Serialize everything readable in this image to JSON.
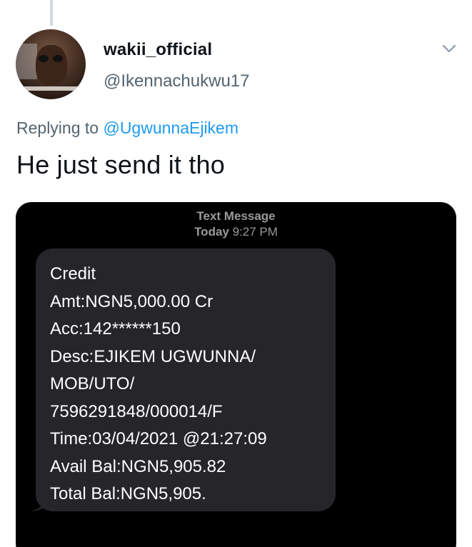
{
  "tweet": {
    "display_name": "wakii_official",
    "handle": "@Ikennachukwu17",
    "replying_prefix": "Replying to",
    "replying_to": "@UgwunnaEjikem",
    "text": "He just send it tho"
  },
  "icons": {
    "more": "chevron-down-icon",
    "avatar": "profile-photo"
  },
  "colors": {
    "accent": "#1d9bf0",
    "secondary_text": "#536471",
    "bubble": "#26252a",
    "media_bg": "#000000"
  },
  "sms": {
    "header_title": "Text Message",
    "header_day": "Today",
    "header_time": "9:27 PM",
    "lines": [
      "Credit",
      "Amt:NGN5,000.00 Cr",
      "Acc:142******150",
      "Desc:EJIKEM UGWUNNA/",
      "MOB/UTO/",
      "7596291848/000014/F",
      "Time:03/04/2021 @21:27:09",
      "Avail Bal:NGN5,905.82",
      "Total Bal:NGN5,905."
    ]
  }
}
